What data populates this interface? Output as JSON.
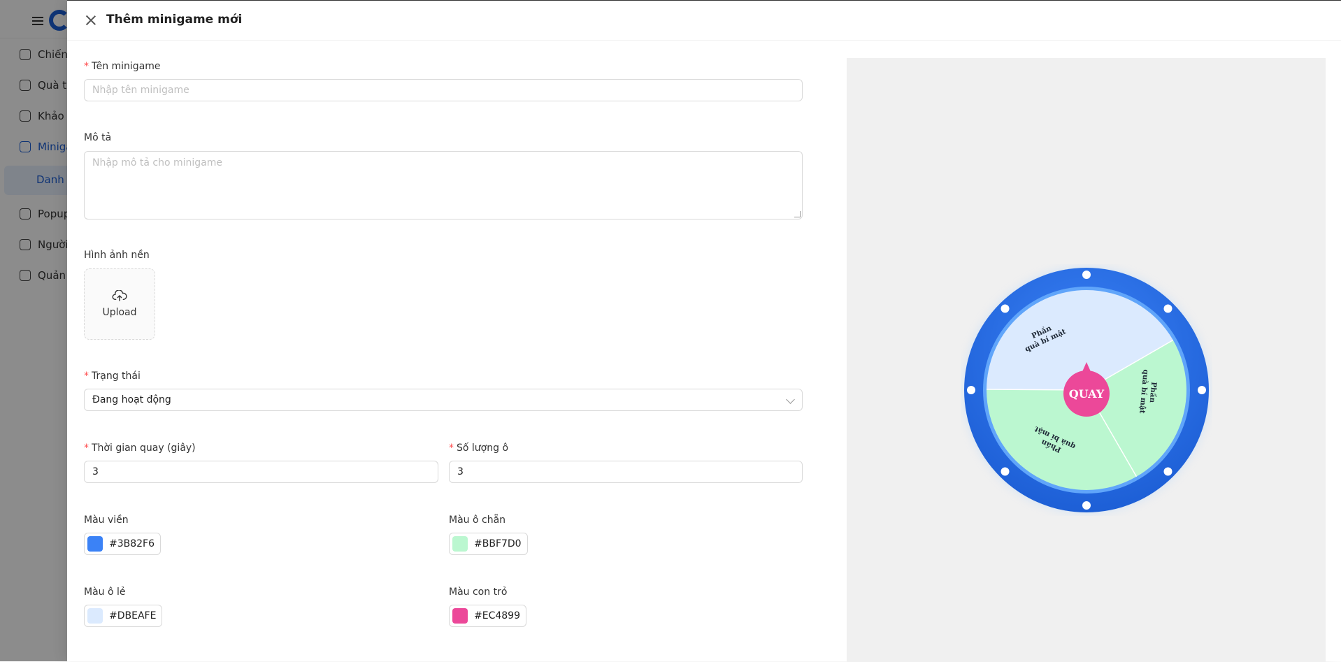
{
  "background_app": {
    "sidebar": {
      "items": [
        {
          "label": "Chiến"
        },
        {
          "label": "Quà tặ"
        },
        {
          "label": "Khảo s"
        },
        {
          "label": "Miniga"
        },
        {
          "label": "Popup"
        },
        {
          "label": "Người"
        },
        {
          "label": "Quản"
        }
      ],
      "sub_item": "Danh s"
    }
  },
  "drawer": {
    "title": "Thêm minigame mới",
    "form": {
      "name": {
        "label": "Tên minigame",
        "required": "*",
        "placeholder": "Nhập tên minigame",
        "value": ""
      },
      "description": {
        "label": "Mô tả",
        "placeholder": "Nhập mô tả cho minigame",
        "value": ""
      },
      "background_image": {
        "label": "Hình ảnh nền",
        "upload_label": "Upload"
      },
      "status": {
        "label": "Trạng thái",
        "required": "*",
        "value": "Đang hoạt động"
      },
      "spin_time": {
        "label": "Thời gian quay (giây)",
        "required": "*",
        "value": "3"
      },
      "slot_count": {
        "label": "Số lượng ô",
        "required": "*",
        "value": "3"
      },
      "border_color": {
        "label": "Màu viền",
        "value": "#3B82F6"
      },
      "even_color": {
        "label": "Màu ô chẵn",
        "value": "#BBF7D0"
      },
      "odd_color": {
        "label": "Màu ô lẻ",
        "value": "#DBEAFE"
      },
      "pointer_color": {
        "label": "Màu con trỏ",
        "value": "#EC4899"
      }
    }
  },
  "preview": {
    "spin_label": "QUAY",
    "segments": [
      {
        "line1": "Phần",
        "line2": "quà bí mật"
      },
      {
        "line1": "Phần",
        "line2": "quà bí mật"
      },
      {
        "line1": "Phần",
        "line2": "quà bí mật"
      }
    ],
    "colors": {
      "border": "#3B82F6",
      "even": "#BBF7D0",
      "odd": "#DBEAFE",
      "pointer": "#EC4899"
    }
  }
}
